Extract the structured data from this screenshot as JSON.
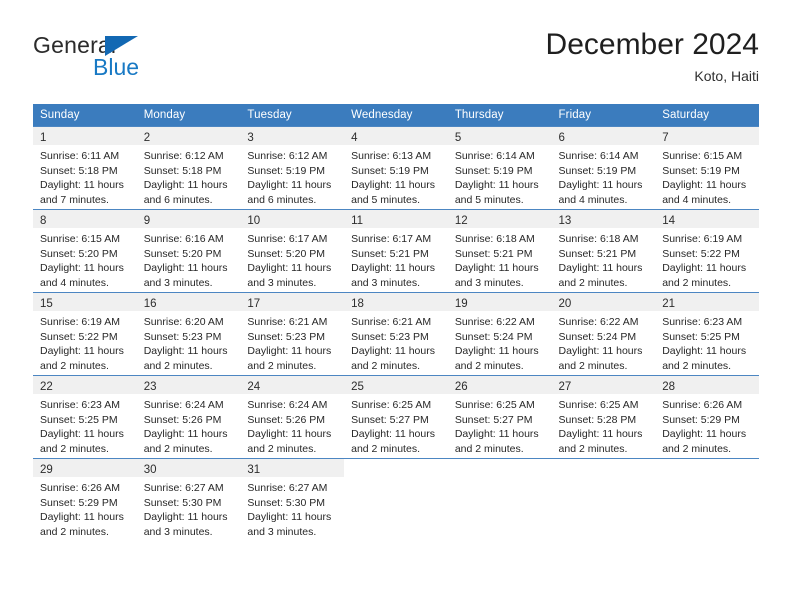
{
  "brand": {
    "name_top": "General",
    "name_bottom": "Blue",
    "triangle_icon": "blue-triangle-icon",
    "color_dark": "#2b2b2b",
    "color_blue": "#1879c4"
  },
  "header": {
    "title": "December 2024",
    "location": "Koto, Haiti"
  },
  "theme": {
    "header_bg": "#3b7cbe",
    "header_text": "#ffffff",
    "daynum_strip_bg": "#f0f0f0",
    "row_border": "#4c86c2",
    "body_text": "#272727"
  },
  "calendar": {
    "weekdays": [
      "Sunday",
      "Monday",
      "Tuesday",
      "Wednesday",
      "Thursday",
      "Friday",
      "Saturday"
    ],
    "weeks": [
      [
        {
          "day": "1",
          "sunrise": "Sunrise: 6:11 AM",
          "sunset": "Sunset: 5:18 PM",
          "daylight_line1": "Daylight: 11 hours",
          "daylight_line2": "and 7 minutes."
        },
        {
          "day": "2",
          "sunrise": "Sunrise: 6:12 AM",
          "sunset": "Sunset: 5:18 PM",
          "daylight_line1": "Daylight: 11 hours",
          "daylight_line2": "and 6 minutes."
        },
        {
          "day": "3",
          "sunrise": "Sunrise: 6:12 AM",
          "sunset": "Sunset: 5:19 PM",
          "daylight_line1": "Daylight: 11 hours",
          "daylight_line2": "and 6 minutes."
        },
        {
          "day": "4",
          "sunrise": "Sunrise: 6:13 AM",
          "sunset": "Sunset: 5:19 PM",
          "daylight_line1": "Daylight: 11 hours",
          "daylight_line2": "and 5 minutes."
        },
        {
          "day": "5",
          "sunrise": "Sunrise: 6:14 AM",
          "sunset": "Sunset: 5:19 PM",
          "daylight_line1": "Daylight: 11 hours",
          "daylight_line2": "and 5 minutes."
        },
        {
          "day": "6",
          "sunrise": "Sunrise: 6:14 AM",
          "sunset": "Sunset: 5:19 PM",
          "daylight_line1": "Daylight: 11 hours",
          "daylight_line2": "and 4 minutes."
        },
        {
          "day": "7",
          "sunrise": "Sunrise: 6:15 AM",
          "sunset": "Sunset: 5:19 PM",
          "daylight_line1": "Daylight: 11 hours",
          "daylight_line2": "and 4 minutes."
        }
      ],
      [
        {
          "day": "8",
          "sunrise": "Sunrise: 6:15 AM",
          "sunset": "Sunset: 5:20 PM",
          "daylight_line1": "Daylight: 11 hours",
          "daylight_line2": "and 4 minutes."
        },
        {
          "day": "9",
          "sunrise": "Sunrise: 6:16 AM",
          "sunset": "Sunset: 5:20 PM",
          "daylight_line1": "Daylight: 11 hours",
          "daylight_line2": "and 3 minutes."
        },
        {
          "day": "10",
          "sunrise": "Sunrise: 6:17 AM",
          "sunset": "Sunset: 5:20 PM",
          "daylight_line1": "Daylight: 11 hours",
          "daylight_line2": "and 3 minutes."
        },
        {
          "day": "11",
          "sunrise": "Sunrise: 6:17 AM",
          "sunset": "Sunset: 5:21 PM",
          "daylight_line1": "Daylight: 11 hours",
          "daylight_line2": "and 3 minutes."
        },
        {
          "day": "12",
          "sunrise": "Sunrise: 6:18 AM",
          "sunset": "Sunset: 5:21 PM",
          "daylight_line1": "Daylight: 11 hours",
          "daylight_line2": "and 3 minutes."
        },
        {
          "day": "13",
          "sunrise": "Sunrise: 6:18 AM",
          "sunset": "Sunset: 5:21 PM",
          "daylight_line1": "Daylight: 11 hours",
          "daylight_line2": "and 2 minutes."
        },
        {
          "day": "14",
          "sunrise": "Sunrise: 6:19 AM",
          "sunset": "Sunset: 5:22 PM",
          "daylight_line1": "Daylight: 11 hours",
          "daylight_line2": "and 2 minutes."
        }
      ],
      [
        {
          "day": "15",
          "sunrise": "Sunrise: 6:19 AM",
          "sunset": "Sunset: 5:22 PM",
          "daylight_line1": "Daylight: 11 hours",
          "daylight_line2": "and 2 minutes."
        },
        {
          "day": "16",
          "sunrise": "Sunrise: 6:20 AM",
          "sunset": "Sunset: 5:23 PM",
          "daylight_line1": "Daylight: 11 hours",
          "daylight_line2": "and 2 minutes."
        },
        {
          "day": "17",
          "sunrise": "Sunrise: 6:21 AM",
          "sunset": "Sunset: 5:23 PM",
          "daylight_line1": "Daylight: 11 hours",
          "daylight_line2": "and 2 minutes."
        },
        {
          "day": "18",
          "sunrise": "Sunrise: 6:21 AM",
          "sunset": "Sunset: 5:23 PM",
          "daylight_line1": "Daylight: 11 hours",
          "daylight_line2": "and 2 minutes."
        },
        {
          "day": "19",
          "sunrise": "Sunrise: 6:22 AM",
          "sunset": "Sunset: 5:24 PM",
          "daylight_line1": "Daylight: 11 hours",
          "daylight_line2": "and 2 minutes."
        },
        {
          "day": "20",
          "sunrise": "Sunrise: 6:22 AM",
          "sunset": "Sunset: 5:24 PM",
          "daylight_line1": "Daylight: 11 hours",
          "daylight_line2": "and 2 minutes."
        },
        {
          "day": "21",
          "sunrise": "Sunrise: 6:23 AM",
          "sunset": "Sunset: 5:25 PM",
          "daylight_line1": "Daylight: 11 hours",
          "daylight_line2": "and 2 minutes."
        }
      ],
      [
        {
          "day": "22",
          "sunrise": "Sunrise: 6:23 AM",
          "sunset": "Sunset: 5:25 PM",
          "daylight_line1": "Daylight: 11 hours",
          "daylight_line2": "and 2 minutes."
        },
        {
          "day": "23",
          "sunrise": "Sunrise: 6:24 AM",
          "sunset": "Sunset: 5:26 PM",
          "daylight_line1": "Daylight: 11 hours",
          "daylight_line2": "and 2 minutes."
        },
        {
          "day": "24",
          "sunrise": "Sunrise: 6:24 AM",
          "sunset": "Sunset: 5:26 PM",
          "daylight_line1": "Daylight: 11 hours",
          "daylight_line2": "and 2 minutes."
        },
        {
          "day": "25",
          "sunrise": "Sunrise: 6:25 AM",
          "sunset": "Sunset: 5:27 PM",
          "daylight_line1": "Daylight: 11 hours",
          "daylight_line2": "and 2 minutes."
        },
        {
          "day": "26",
          "sunrise": "Sunrise: 6:25 AM",
          "sunset": "Sunset: 5:27 PM",
          "daylight_line1": "Daylight: 11 hours",
          "daylight_line2": "and 2 minutes."
        },
        {
          "day": "27",
          "sunrise": "Sunrise: 6:25 AM",
          "sunset": "Sunset: 5:28 PM",
          "daylight_line1": "Daylight: 11 hours",
          "daylight_line2": "and 2 minutes."
        },
        {
          "day": "28",
          "sunrise": "Sunrise: 6:26 AM",
          "sunset": "Sunset: 5:29 PM",
          "daylight_line1": "Daylight: 11 hours",
          "daylight_line2": "and 2 minutes."
        }
      ],
      [
        {
          "day": "29",
          "sunrise": "Sunrise: 6:26 AM",
          "sunset": "Sunset: 5:29 PM",
          "daylight_line1": "Daylight: 11 hours",
          "daylight_line2": "and 2 minutes."
        },
        {
          "day": "30",
          "sunrise": "Sunrise: 6:27 AM",
          "sunset": "Sunset: 5:30 PM",
          "daylight_line1": "Daylight: 11 hours",
          "daylight_line2": "and 3 minutes."
        },
        {
          "day": "31",
          "sunrise": "Sunrise: 6:27 AM",
          "sunset": "Sunset: 5:30 PM",
          "daylight_line1": "Daylight: 11 hours",
          "daylight_line2": "and 3 minutes."
        },
        {
          "day": "",
          "sunrise": "",
          "sunset": "",
          "daylight_line1": "",
          "daylight_line2": ""
        },
        {
          "day": "",
          "sunrise": "",
          "sunset": "",
          "daylight_line1": "",
          "daylight_line2": ""
        },
        {
          "day": "",
          "sunrise": "",
          "sunset": "",
          "daylight_line1": "",
          "daylight_line2": ""
        },
        {
          "day": "",
          "sunrise": "",
          "sunset": "",
          "daylight_line1": "",
          "daylight_line2": ""
        }
      ]
    ]
  }
}
